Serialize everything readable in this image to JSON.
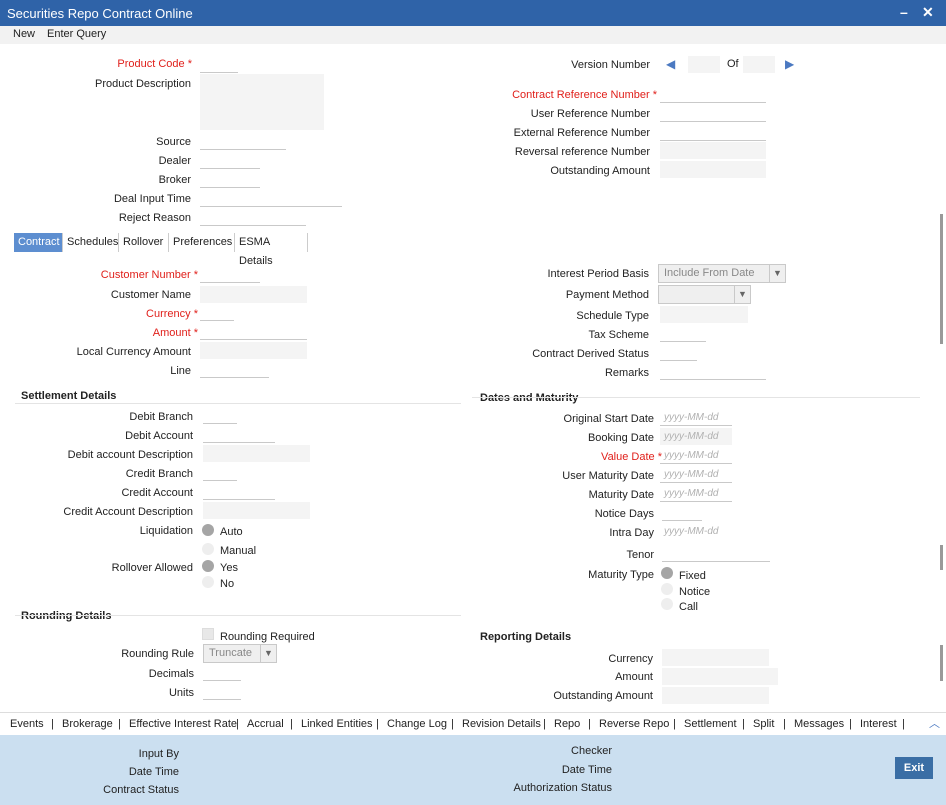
{
  "window": {
    "title": "Securities Repo Contract Online",
    "minimize": "–",
    "close": "✕"
  },
  "menu": {
    "new": "New",
    "enter_query": "Enter Query"
  },
  "header": {
    "product_code": "Product Code",
    "product_description": "Product Description",
    "source": "Source",
    "dealer": "Dealer",
    "broker": "Broker",
    "deal_input_time": "Deal Input Time",
    "reject_reason": "Reject Reason",
    "version_number": "Version Number",
    "of": "Of",
    "contract_reference_number": "Contract Reference Number",
    "user_reference_number": "User Reference Number",
    "external_reference_number": "External Reference Number",
    "reversal_reference_number": "Reversal reference Number",
    "outstanding_amount": "Outstanding Amount"
  },
  "tabs": [
    "Contract",
    "Schedules",
    "Rollover",
    "Preferences",
    "ESMA Details"
  ],
  "contract": {
    "customer_number": "Customer Number",
    "customer_name": "Customer Name",
    "currency": "Currency",
    "amount": "Amount",
    "local_currency_amount": "Local Currency Amount",
    "line": "Line",
    "interest_period_basis": "Interest Period Basis",
    "interest_period_basis_value": "Include From Date",
    "payment_method": "Payment Method",
    "schedule_type": "Schedule Type",
    "tax_scheme": "Tax Scheme",
    "contract_derived_status": "Contract Derived Status",
    "remarks": "Remarks"
  },
  "settlement": {
    "title": "Settlement Details",
    "debit_branch": "Debit Branch",
    "debit_account": "Debit Account",
    "debit_account_description": "Debit account Description",
    "credit_branch": "Credit Branch",
    "credit_account": "Credit Account",
    "credit_account_description": "Credit Account Description",
    "liquidation": "Liquidation",
    "auto": "Auto",
    "manual": "Manual",
    "rollover_allowed": "Rollover Allowed",
    "yes": "Yes",
    "no": "No"
  },
  "dates": {
    "title": "Dates and Maturity",
    "original_start_date": "Original Start Date",
    "booking_date": "Booking Date",
    "value_date": "Value Date",
    "user_maturity_date": "User Maturity Date",
    "maturity_date": "Maturity Date",
    "notice_days": "Notice Days",
    "intra_day": "Intra Day",
    "tenor": "Tenor",
    "maturity_type": "Maturity Type",
    "fixed": "Fixed",
    "notice": "Notice",
    "call": "Call",
    "date_placeholder": "yyyy-MM-dd"
  },
  "rounding": {
    "title": "Rounding Details",
    "rounding_required": "Rounding Required",
    "rounding_rule": "Rounding Rule",
    "rounding_rule_value": "Truncate",
    "decimals": "Decimals",
    "units": "Units"
  },
  "reporting": {
    "title": "Reporting Details",
    "currency": "Currency",
    "amount": "Amount",
    "outstanding_amount": "Outstanding Amount"
  },
  "subsystems": [
    "Events",
    "Brokerage",
    "Effective Interest Rate",
    "Accrual",
    "Linked Entities",
    "Change Log",
    "Revision Details",
    "Repo",
    "Reverse Repo",
    "Settlement",
    "Split",
    "Messages",
    "Interest"
  ],
  "footer": {
    "input_by": "Input By",
    "date_time": "Date Time",
    "contract_status": "Contract Status",
    "checker": "Checker",
    "date_time_2": "Date Time",
    "authorization_status": "Authorization Status",
    "exit": "Exit"
  },
  "colors": {
    "title_bar": "#2f63a8",
    "required": "#e0201b",
    "active_tab": "#5d8ed0",
    "footer": "#cbdff0"
  }
}
